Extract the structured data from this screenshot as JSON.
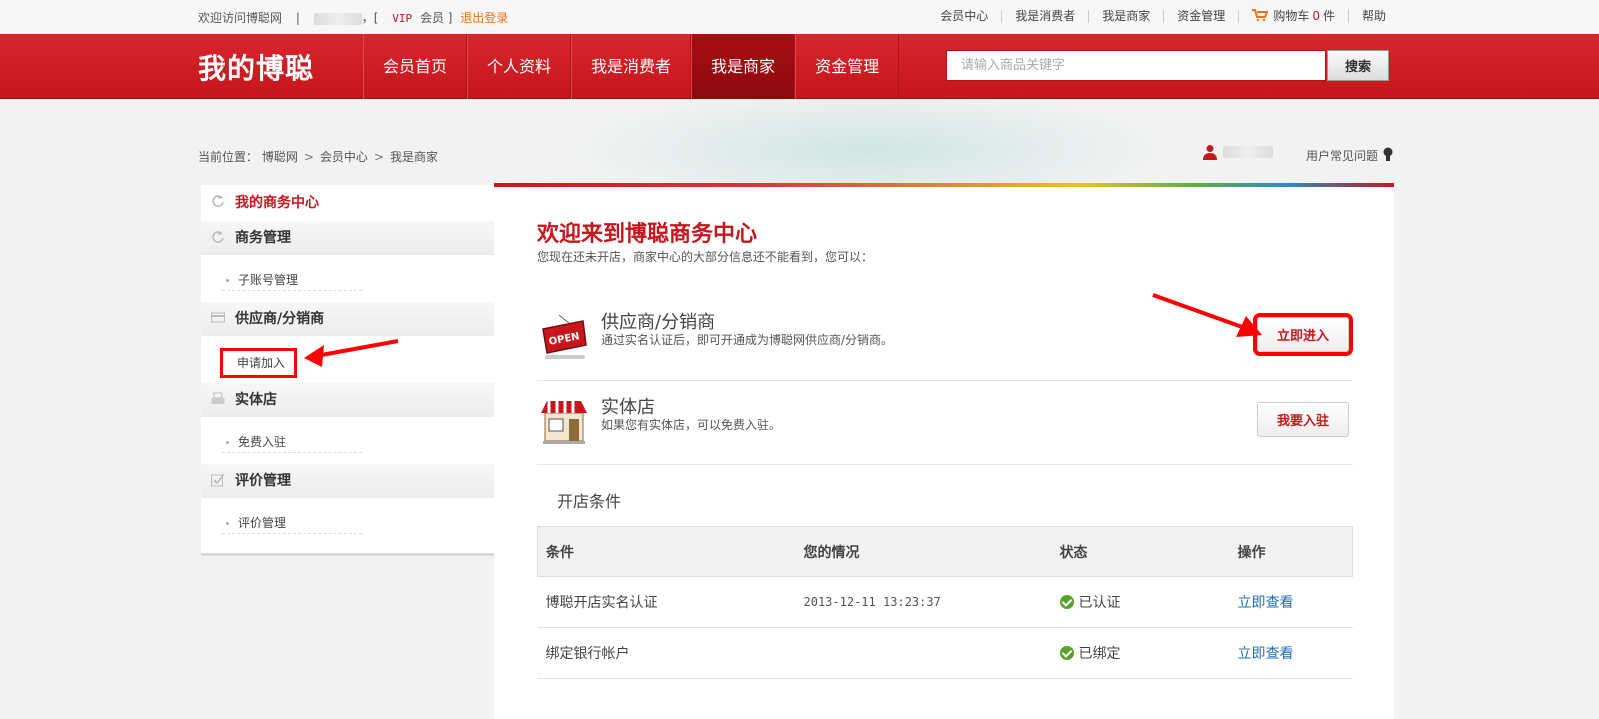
{
  "topbar": {
    "welcome": "欢迎访问博聪网",
    "divider": "|",
    "bracket_open": "，[",
    "vip": "VIP",
    "member": "会员",
    "bracket_close": "]",
    "logout": "退出登录",
    "links": [
      "会员中心",
      "我是消费者",
      "我是商家",
      "资金管理"
    ],
    "cart_label": "购物车",
    "cart_count": "0",
    "cart_unit": "件",
    "help": "帮助"
  },
  "header": {
    "logo": "我的博聪",
    "nav": [
      "会员首页",
      "个人资料",
      "我是消费者",
      "我是商家",
      "资金管理"
    ],
    "active_nav": "我是商家",
    "search_placeholder": "请输入商品关键字",
    "search_button": "搜索",
    "brand_color": "#c8161d"
  },
  "breadcrumb": {
    "prefix": "当前位置：",
    "items": [
      "博聪网",
      "会员中心",
      "我是商家"
    ],
    "separator": ">"
  },
  "faq": "用户常见问题",
  "sidebar": {
    "title": "我的商务中心",
    "sections": [
      {
        "head": "商务管理",
        "icon": "refresh-icon",
        "item": "子账号管理"
      },
      {
        "head": "供应商/分销商",
        "icon": "card-icon",
        "item": "申请加入"
      },
      {
        "head": "实体店",
        "icon": "printer-icon",
        "item": "免费入驻"
      },
      {
        "head": "评价管理",
        "icon": "checkbox-icon",
        "item": "评价管理"
      }
    ]
  },
  "main": {
    "welcome": "欢迎来到博聪商务中心",
    "welcome_sub": "您现在还未开店，商家中心的大部分信息还不能看到，您可以：",
    "rows": [
      {
        "title": "供应商/分销商",
        "desc": "通过实名认证后，即可开通成为博聪网供应商/分销商。",
        "button": "立即进入",
        "icon": "open-sign-icon"
      },
      {
        "title": "实体店",
        "desc": "如果您有实体店，可以免费入驻。",
        "button": "我要入驻",
        "icon": "shop-icon"
      }
    ],
    "conditions_title": "开店条件",
    "table": {
      "headers": [
        "条件",
        "您的情况",
        "状态",
        "操作"
      ],
      "rows": [
        {
          "condition": "博聪开店实名认证",
          "situation": "2013-12-11 13:23:37",
          "status": "已认证",
          "action": "立即查看"
        },
        {
          "condition": "绑定银行帐户",
          "situation": "",
          "status": "已绑定",
          "action": "立即查看"
        }
      ]
    },
    "annotation_color": "#ff0000"
  }
}
